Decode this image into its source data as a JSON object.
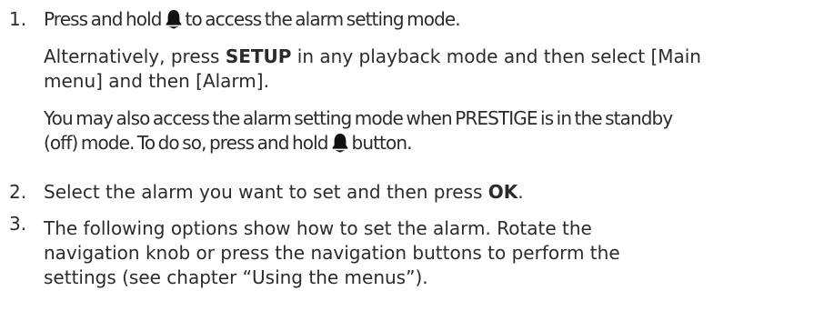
{
  "steps": [
    {
      "number": "1.",
      "line1_before": "Press and hold",
      "line1_after": "to access the alarm setting mode.",
      "alt_prefix": "Alternatively, press ",
      "alt_setup": "SETUP",
      "alt_line1_rest": " in any playback mode and then select [Main",
      "alt_line2": "menu] and then [Alarm].",
      "standby_line1": "You may also access the alarm setting mode when PRESTIGE is in the standby",
      "standby_line2_before": "(off) mode. To do so, press and hold",
      "standby_line2_after": "button."
    },
    {
      "number": "2.",
      "text_before": "Select the alarm you want to set and then press ",
      "ok": "OK",
      "text_after": "."
    },
    {
      "number": "3.",
      "line1": "The following options show how to set the alarm. Rotate the",
      "line2": "navigation knob or press the navigation buttons to perform the",
      "line3": "settings (see chapter “Using the menus”)."
    }
  ],
  "icons": {
    "bell": "alarm-bell-icon"
  }
}
